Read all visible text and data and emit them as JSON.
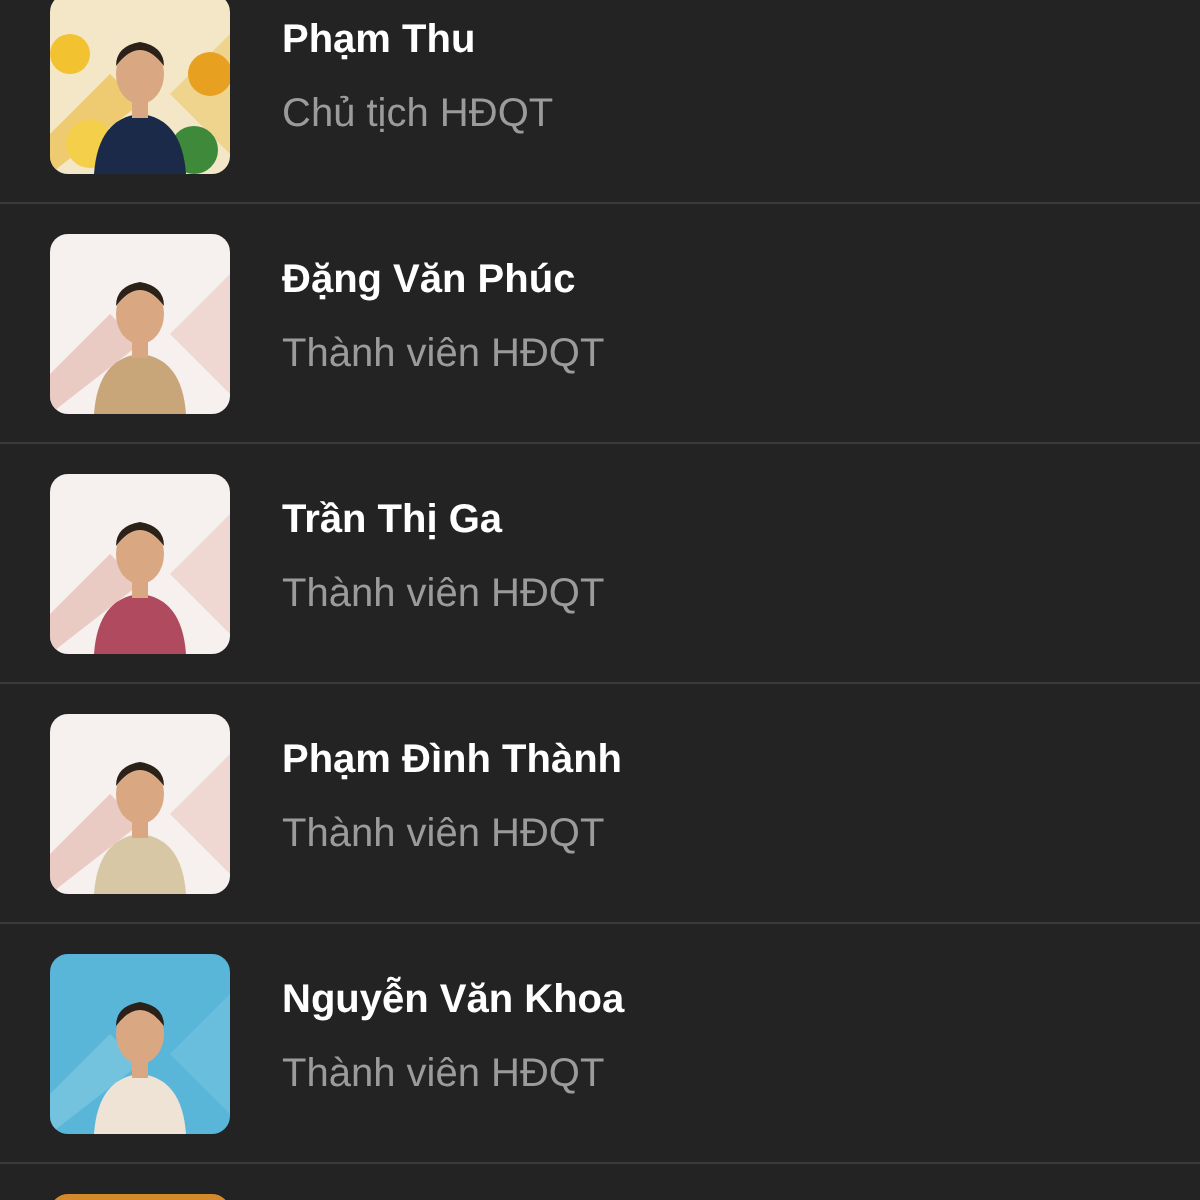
{
  "members": [
    {
      "kind": "member",
      "name": "Phạm Thu",
      "role": "Chủ tịch HĐQT"
    },
    {
      "kind": "member",
      "name": "Đặng Văn Phúc",
      "role": "Thành viên HĐQT"
    },
    {
      "kind": "member",
      "name": "Trần Thị Ga",
      "role": "Thành viên HĐQT"
    },
    {
      "kind": "member",
      "name": "Phạm Đình Thành",
      "role": "Thành viên HĐQT"
    },
    {
      "kind": "member",
      "name": "Nguyễn Văn Khoa",
      "role": "Thành viên HĐQT"
    },
    {
      "kind": "cut-off"
    }
  ]
}
